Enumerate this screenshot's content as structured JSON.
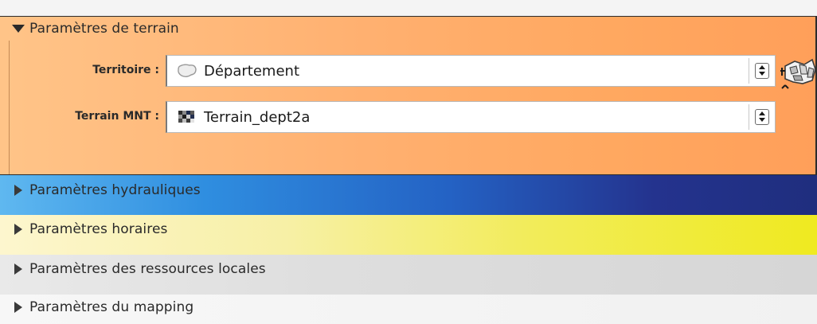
{
  "groups": {
    "terrain": {
      "title": "Paramètres de terrain",
      "expanded": true,
      "fields": [
        {
          "label": "Territoire :",
          "value": "Département",
          "icon": "polygon-layer-icon"
        },
        {
          "label": "Terrain MNT :",
          "value": "Terrain_dept2a",
          "icon": "raster-layer-icon"
        }
      ]
    },
    "hydrauliques": {
      "title": "Paramètres hydrauliques",
      "expanded": false
    },
    "horaires": {
      "title": "Paramètres horaires",
      "expanded": false
    },
    "ressources": {
      "title": "Paramètres des ressources locales",
      "expanded": false
    },
    "mapping": {
      "title": "Paramètres du mapping",
      "expanded": false
    }
  },
  "colors": {
    "terrain_bg": "#ffb070",
    "hydrauliques_bg": "#2462c4",
    "horaires_bg": "#efea20",
    "ressources_bg": "#dedede",
    "mapping_bg": "#f3f3f3"
  },
  "icons": {
    "expanded": "triangle-down-icon",
    "collapsed": "triangle-right-icon",
    "spinbox": "spin-updown-icon",
    "select_on_map": "map-select-icon"
  }
}
